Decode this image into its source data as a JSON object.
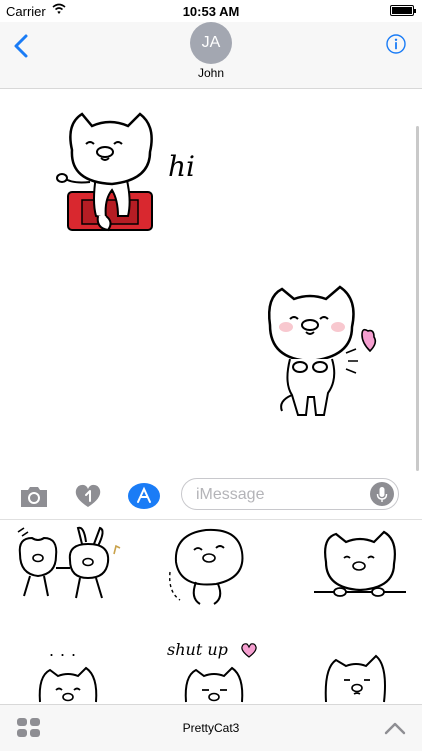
{
  "status_bar": {
    "carrier": "Carrier",
    "time": "10:53 AM",
    "battery_level": 1.0
  },
  "header": {
    "avatar_initials": "JA",
    "contact_name": "John"
  },
  "conversation": {
    "messages": [
      {
        "type": "sticker",
        "icon": "cat-on-red-chair-sticker",
        "caption": "hi"
      },
      {
        "type": "sticker",
        "icon": "cat-blowing-heart-sticker"
      }
    ]
  },
  "input_bar": {
    "placeholder": "iMessage",
    "icons": [
      "camera-icon",
      "digital-touch-heart-icon",
      "app-store-icon",
      "microphone-icon"
    ]
  },
  "sticker_drawer": {
    "stickers": [
      {
        "icon": "cat-and-rabbit-dancing-sticker"
      },
      {
        "icon": "cat-rolling-sticker"
      },
      {
        "icon": "cat-peeking-over-line-sticker"
      },
      {
        "icon": "cat-dots-sticker",
        "caption": "..."
      },
      {
        "icon": "cat-shut-up-sticker",
        "caption": "shut up"
      },
      {
        "icon": "cat-side-eye-sticker"
      }
    ]
  },
  "bottom_bar": {
    "pack_name": "PrettyCat3"
  },
  "colors": {
    "ios_blue": "#1a7cf6",
    "avatar_gray": "#a3a7b1",
    "bar_gray": "#f7f7f7",
    "chair_red": "#d9282f",
    "heart_pink": "#f59fd0"
  }
}
